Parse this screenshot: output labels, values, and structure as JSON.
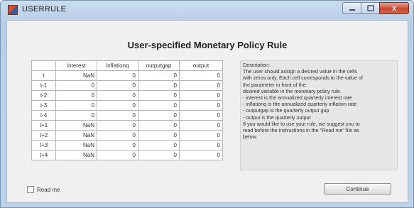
{
  "window": {
    "title": "USERRULE",
    "icon": "matlab-icon",
    "controls": {
      "minimize_icon": "minimize-icon",
      "maximize_icon": "maximize-icon",
      "close_icon": "close-icon",
      "close_glyph": "x"
    }
  },
  "heading": "User-specified Monetary Policy Rule",
  "table": {
    "columns": [
      "interest",
      "inflationq",
      "outputgap",
      "output"
    ],
    "rows": [
      {
        "label": "t",
        "values": [
          "NaN",
          "0",
          "0",
          "0"
        ]
      },
      {
        "label": "t-1",
        "values": [
          "0",
          "0",
          "0",
          "0"
        ]
      },
      {
        "label": "t-2",
        "values": [
          "0",
          "0",
          "0",
          "0"
        ]
      },
      {
        "label": "t-3",
        "values": [
          "0",
          "0",
          "0",
          "0"
        ]
      },
      {
        "label": "t-4",
        "values": [
          "0",
          "0",
          "0",
          "0"
        ]
      },
      {
        "label": "t+1",
        "values": [
          "NaN",
          "0",
          "0",
          "0"
        ]
      },
      {
        "label": "t+2",
        "values": [
          "NaN",
          "0",
          "0",
          "0"
        ]
      },
      {
        "label": "t+3",
        "values": [
          "NaN",
          "0",
          "0",
          "0"
        ]
      },
      {
        "label": "t+4",
        "values": [
          "NaN",
          "0",
          "0",
          "0"
        ]
      }
    ]
  },
  "description": {
    "lines": [
      "Description:",
      "The user should assign a desired value in the cells",
      "with zeros only. Each cell corresponds to the value of",
      "the parameter in front of the",
      "desired variable in the monetary policy rule.",
      "- interest is the annualized quarterly interest rate",
      "- inflationq is the annualized quarterly inflation rate",
      "- outputgap is the quarterly output gap",
      "- output is the quarterly output",
      "If you would like to use your rule, we suggest you to",
      "read before the instructions in the \"Read me\" file as",
      "below."
    ]
  },
  "readme": {
    "label": "Read me",
    "checked": false
  },
  "continue_button": {
    "label": "Continue"
  }
}
